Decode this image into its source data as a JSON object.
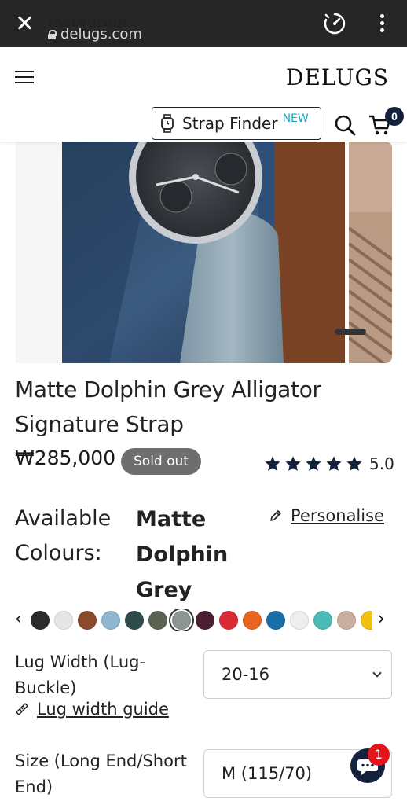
{
  "browser": {
    "title": "Instagram",
    "url": "delugs.com"
  },
  "header": {
    "logo": "DELUGS",
    "strap_finder_label": "Strap Finder",
    "strap_finder_badge": "NEW",
    "cart_count": "0"
  },
  "product": {
    "title_line1": "Matte Dolphin Grey Alligator",
    "title_line2": "Signature Strap",
    "price": "₩285,000",
    "status_badge": "Sold out",
    "rating": "5.0",
    "rating_stars": 5,
    "available_colours_label_line1": "Available",
    "available_colours_label_line2": "Colours:",
    "selected_colour_line1": "Matte",
    "selected_colour_line2": "Dolphin",
    "selected_colour_line3": "Grey",
    "personalise_label": "Personalise"
  },
  "swatches": {
    "colors": [
      "#2b2b2b",
      "#e6e6e6",
      "#8b4a2b",
      "#8fb6cf",
      "#2f4a4a",
      "#5b6450",
      "#8b9591",
      "#4a1f33",
      "#d82b34",
      "#e8651f",
      "#1a6ea8",
      "#eeeeee",
      "#4cbab5",
      "#c9ad9e",
      "#f2c10f"
    ],
    "selected_index": 6
  },
  "options": {
    "lug_width_label_line1": "Lug Width (Lug-",
    "lug_width_label_line2": "Buckle)",
    "lug_width_value": "20-16",
    "lug_width_guide": "Lug width guide",
    "size_label_line1": "Size (Long End/Short",
    "size_label_line2": "End)",
    "size_value": "M (115/70)"
  },
  "chat": {
    "unread_count": "1"
  },
  "colors": {
    "navy": "#14213d",
    "badge_red": "#e4151a",
    "new_blue": "#11a8c7",
    "soldout_grey": "#6e6e6e"
  }
}
